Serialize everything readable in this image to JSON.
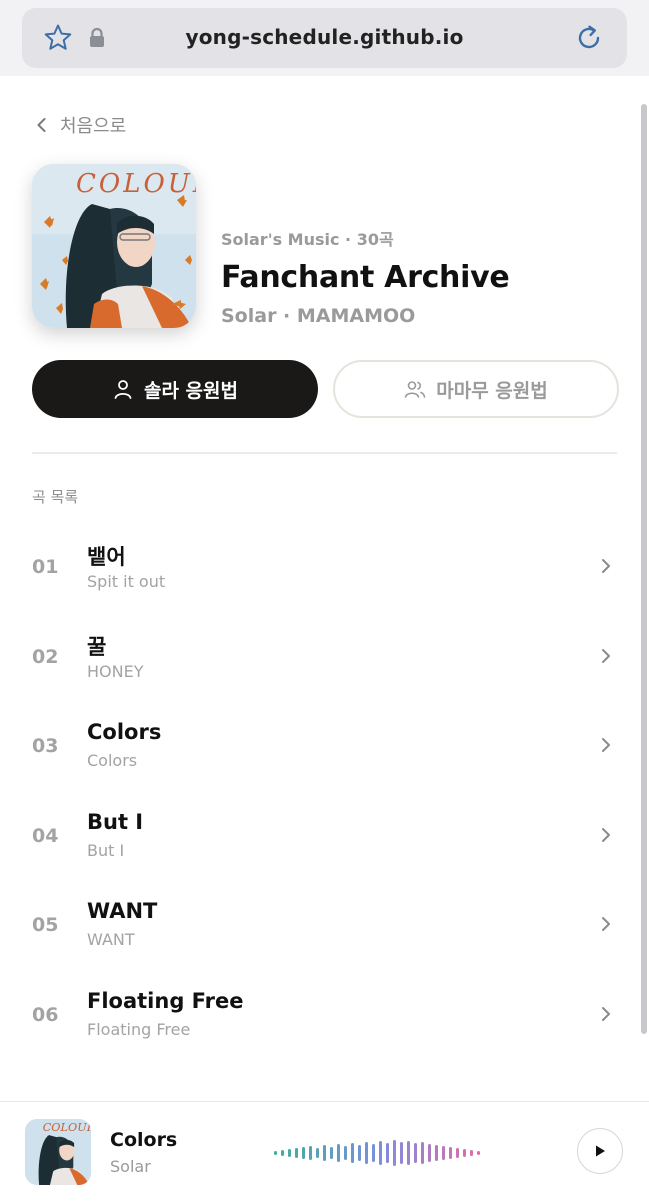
{
  "browser": {
    "url": "yong-schedule.github.io",
    "icons": [
      "star-icon",
      "lock-icon",
      "reload-icon"
    ]
  },
  "nav": {
    "back_label": "처음으로"
  },
  "album": {
    "art_text": "COLOURS",
    "subtitle": "Solar's Music · 30곡",
    "title": "Fanchant Archive",
    "artist": "Solar · MAMAMOO"
  },
  "actions": {
    "solar_label": "솔라 응원법",
    "mamamoo_label": "마마무 응원법"
  },
  "tracklist": {
    "header": "곡 목록",
    "tracks": [
      {
        "num": "01",
        "title": "뱉어",
        "subtitle": "Spit it out"
      },
      {
        "num": "02",
        "title": "꿀",
        "subtitle": "HONEY"
      },
      {
        "num": "03",
        "title": "Colors",
        "subtitle": "Colors"
      },
      {
        "num": "04",
        "title": "But I",
        "subtitle": "But I"
      },
      {
        "num": "05",
        "title": "WANT",
        "subtitle": "WANT"
      },
      {
        "num": "06",
        "title": "Floating Free",
        "subtitle": "Floating Free"
      }
    ]
  },
  "player": {
    "title": "Colors",
    "artist": "Solar"
  },
  "colors": {
    "primary_button": "#1a1918",
    "muted_text": "#9a9a9a",
    "wave_start": "#3fae9a",
    "wave_mid": "#7b8fe0",
    "wave_end": "#e06aa8"
  }
}
